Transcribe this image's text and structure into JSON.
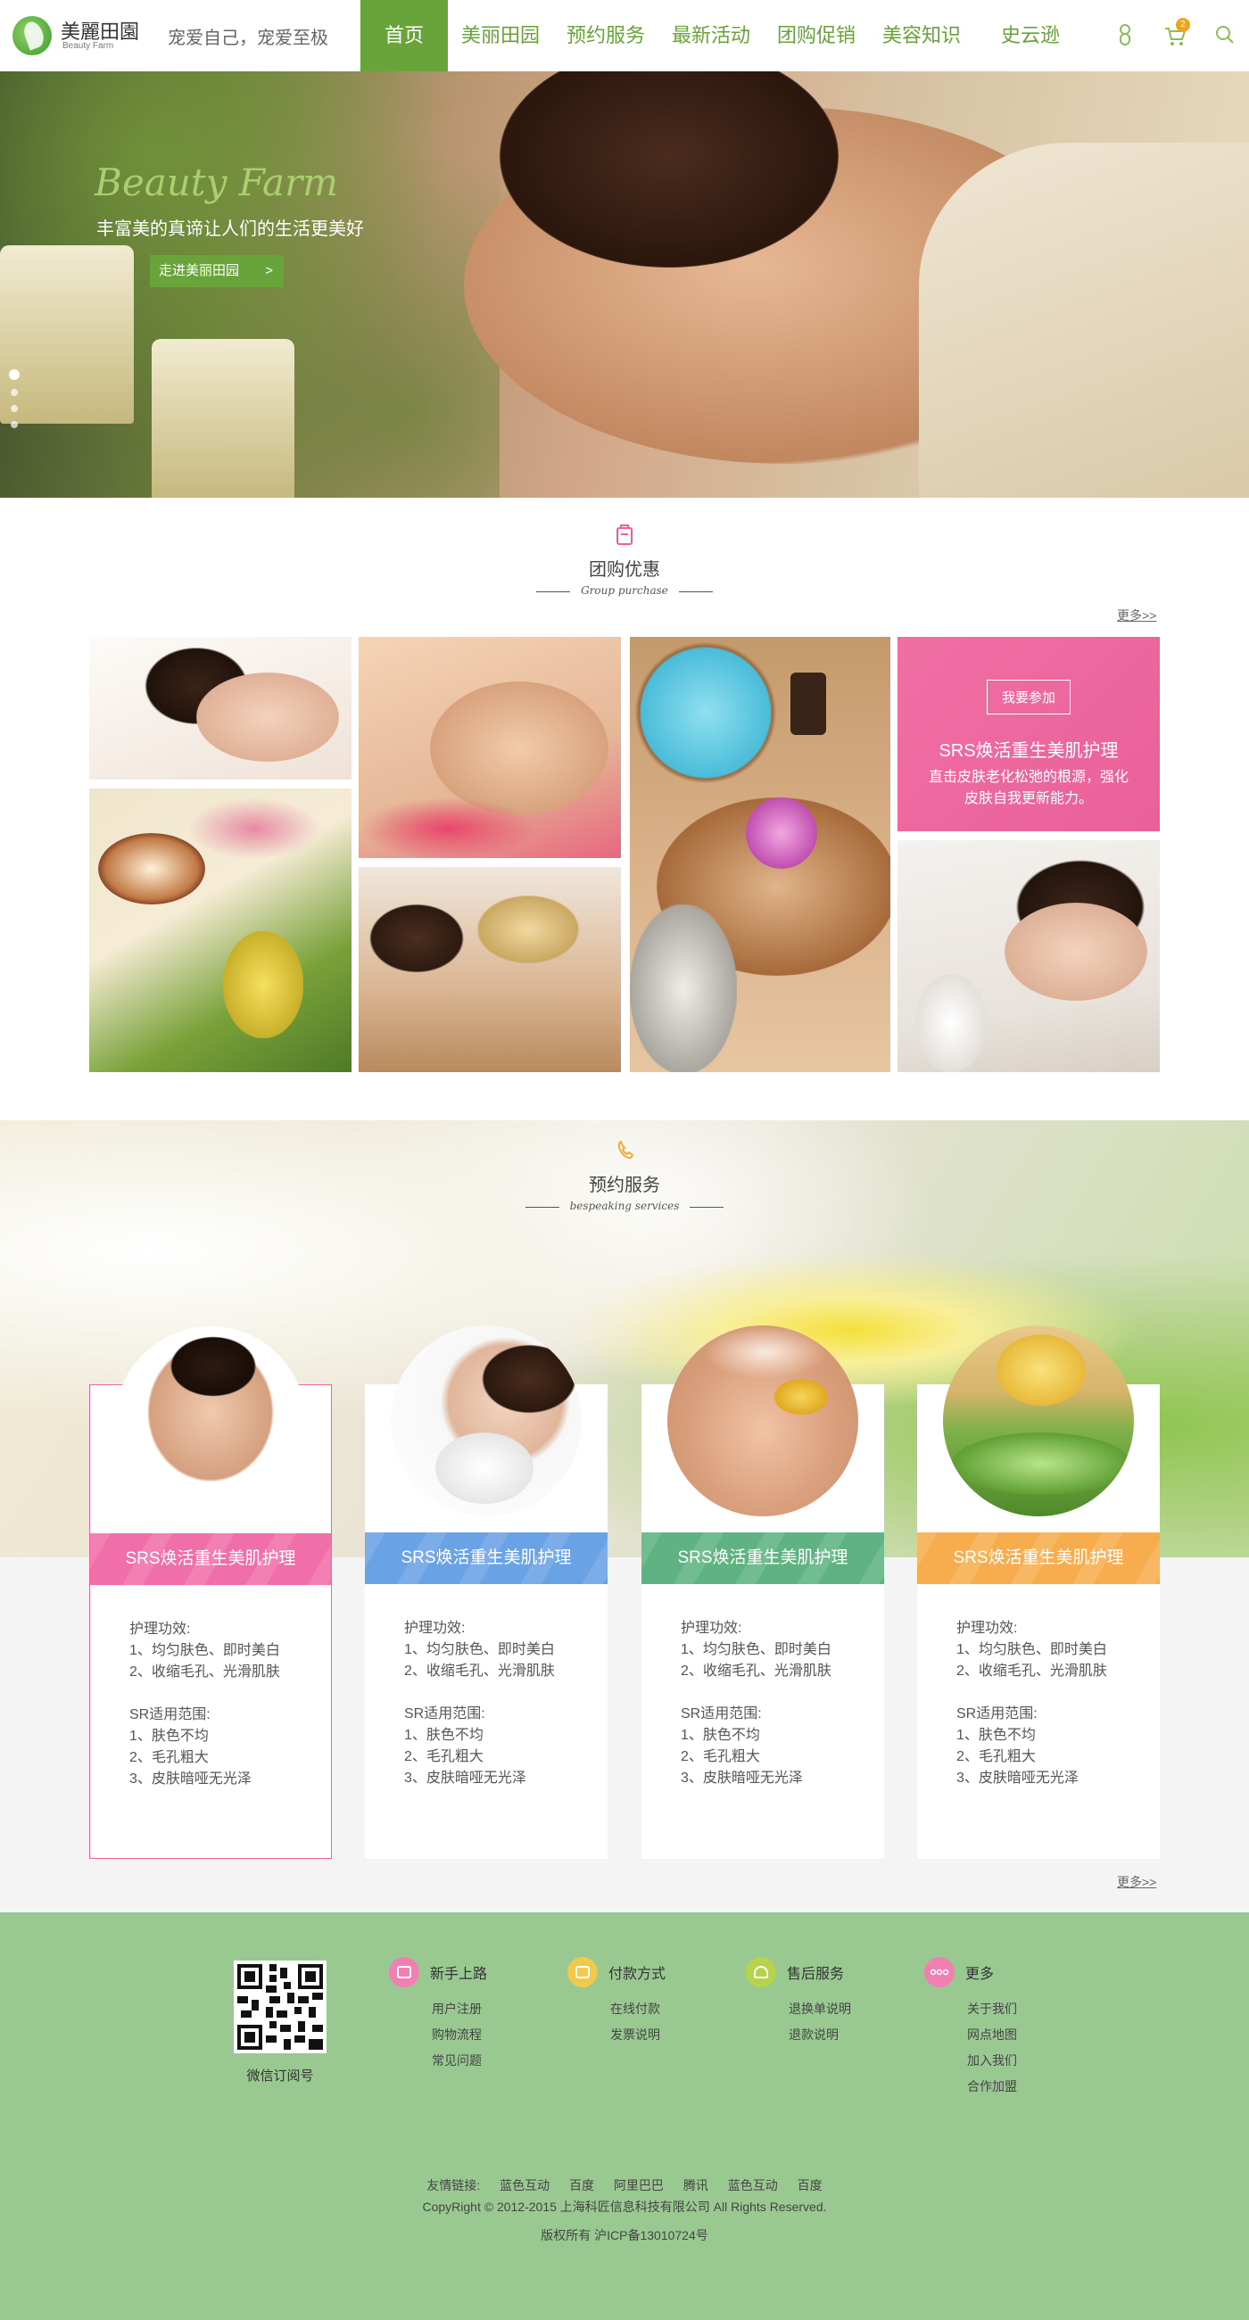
{
  "header": {
    "logo_cn": "美麗田園",
    "logo_en": "Beauty Farm",
    "slogan": "宠爱自己，宠爱至极",
    "nav": [
      {
        "label": "首页",
        "active": true
      },
      {
        "label": "美丽田园"
      },
      {
        "label": "预约服务"
      },
      {
        "label": "最新活动"
      },
      {
        "label": "团购促销"
      },
      {
        "label": "美容知识"
      },
      {
        "label": "史云逊"
      }
    ],
    "icons": [
      "user-icon",
      "cart-icon",
      "search-icon"
    ],
    "cart_count": "2",
    "accent": "#68a43a"
  },
  "hero": {
    "title": "Beauty Farm",
    "subtitle": "丰富美的真谛让人们的生活更美好",
    "button": "走进美丽田园",
    "button_arrow": ">",
    "slides": 4,
    "active_slide": 1
  },
  "group": {
    "title": "团购优惠",
    "subtitle": "Group purchase",
    "more": "更多>>",
    "promo": {
      "button": "我要参加",
      "title": "SRS焕活重生美肌护理",
      "desc1": "直击皮肤老化松弛的根源，强化",
      "desc2": "皮肤自我更新能力。"
    }
  },
  "booking": {
    "title": "预约服务",
    "subtitle": "bespeaking services",
    "more": "更多>>",
    "cards": [
      {
        "title": "SRS焕活重生美肌护理",
        "color": "#f06fa8",
        "effect_head": "护理功效:",
        "effects": [
          "1、均匀肤色、即时美白",
          "2、收缩毛孔、光滑肌肤"
        ],
        "scope_head": "SR适用范围:",
        "scopes": [
          "1、肤色不均",
          "2、毛孔粗大",
          "3、皮肤暗哑无光泽"
        ]
      },
      {
        "title": "SRS焕活重生美肌护理",
        "color": "#6aa2e6",
        "effect_head": "护理功效:",
        "effects": [
          "1、均匀肤色、即时美白",
          "2、收缩毛孔、光滑肌肤"
        ],
        "scope_head": "SR适用范围:",
        "scopes": [
          "1、肤色不均",
          "2、毛孔粗大",
          "3、皮肤暗哑无光泽"
        ]
      },
      {
        "title": "SRS焕活重生美肌护理",
        "color": "#5fb382",
        "effect_head": "护理功效:",
        "effects": [
          "1、均匀肤色、即时美白",
          "2、收缩毛孔、光滑肌肤"
        ],
        "scope_head": "SR适用范围:",
        "scopes": [
          "1、肤色不均",
          "2、毛孔粗大",
          "3、皮肤暗哑无光泽"
        ]
      },
      {
        "title": "SRS焕活重生美肌护理",
        "color": "#f7ad4d",
        "effect_head": "护理功效:",
        "effects": [
          "1、均匀肤色、即时美白",
          "2、收缩毛孔、光滑肌肤"
        ],
        "scope_head": "SR适用范围:",
        "scopes": [
          "1、肤色不均",
          "2、毛孔粗大",
          "3、皮肤暗哑无光泽"
        ]
      }
    ]
  },
  "footer": {
    "qr_label": "微信订阅号",
    "columns": [
      {
        "title": "新手上路",
        "icon": "user-card-icon",
        "color": "#f27fb2",
        "links": [
          "用户注册",
          "购物流程",
          "常见问题"
        ]
      },
      {
        "title": "付款方式",
        "icon": "wallet-icon",
        "color": "#f1c94b",
        "links": [
          "在线付款",
          "发票说明"
        ]
      },
      {
        "title": "售后服务",
        "icon": "headset-icon",
        "color": "#b6d34a",
        "links": [
          "退换单说明",
          "退款说明"
        ]
      },
      {
        "title": "更多",
        "icon": "more-icon",
        "color": "#f27fb2",
        "links": [
          "关于我们",
          "网点地图",
          "加入我们",
          "合作加盟"
        ]
      }
    ],
    "friend_label": "友情链接:",
    "friends": [
      "蓝色互动",
      "百度",
      "阿里巴巴",
      "腾讯",
      "蓝色互动",
      "百度"
    ],
    "copyright": "CopyRight © 2012-2015 上海科匠信息科技有限公司 All Rights Reserved.",
    "icp": "版权所有 沪ICP备13010724号"
  }
}
